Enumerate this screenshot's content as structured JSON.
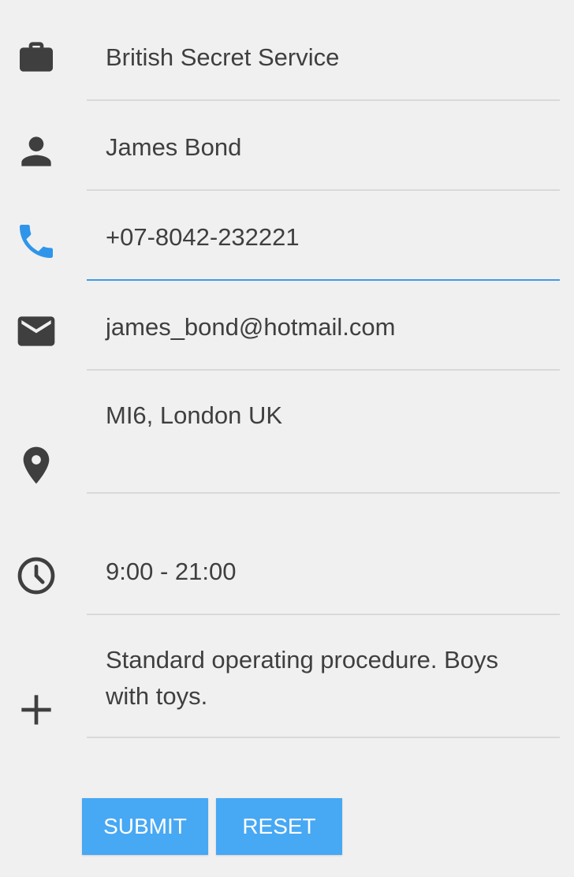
{
  "form": {
    "organization": "British Secret Service",
    "name": "James Bond",
    "phone": "+07-8042-232221",
    "email": "james_bond@hotmail.com",
    "address": "MI6, London UK",
    "hours": "9:00 - 21:00",
    "notes": "Standard operating procedure. Boys with toys."
  },
  "buttons": {
    "submit": "SUBMIT",
    "reset": "RESET"
  },
  "icons": {
    "organization": "briefcase-icon",
    "name": "person-icon",
    "phone": "phone-icon",
    "email": "mail-icon",
    "address": "location-pin-icon",
    "hours": "clock-icon",
    "notes": "plus-icon"
  },
  "colors": {
    "background": "#f0f0f0",
    "icon": "#3f3f3f",
    "active_icon": "#2f95ea",
    "divider": "#d9d9d9",
    "focus_line": "#3f9be8",
    "button": "#47a8f4",
    "button_text": "#ffffff"
  }
}
